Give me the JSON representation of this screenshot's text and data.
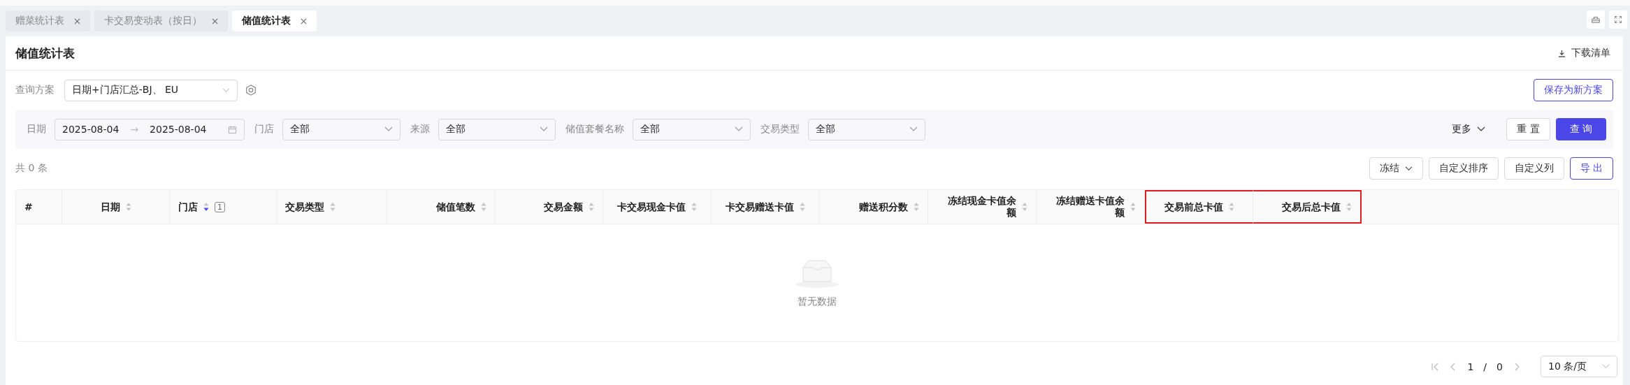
{
  "tabs": [
    {
      "label": "赠菜统计表",
      "selected": false
    },
    {
      "label": "卡交易变动表（按日）",
      "selected": false
    },
    {
      "label": "储值统计表",
      "selected": true
    }
  ],
  "page": {
    "title": "储值统计表",
    "download": "下载清单"
  },
  "scheme": {
    "label": "查询方案",
    "value": "日期+门店汇总-BJ、 EU",
    "save": "保存为新方案"
  },
  "filters": [
    {
      "kind": "daterange",
      "label": "日期",
      "start": "2025-08-04",
      "separator": "→",
      "end": "2025-08-04"
    },
    {
      "kind": "select",
      "label": "门店",
      "value": "全部"
    },
    {
      "kind": "select",
      "label": "来源",
      "value": "全部"
    },
    {
      "kind": "select",
      "label": "储值套餐名称",
      "value": "全部"
    },
    {
      "kind": "select",
      "label": "交易类型",
      "value": "全部"
    }
  ],
  "filter_actions": {
    "more": "更多",
    "reset": "重 置",
    "query": "查 询"
  },
  "count": "共 0 条",
  "table_actions": [
    {
      "kind": "dropdown",
      "label": "冻结"
    },
    {
      "kind": "plain",
      "label": "自定义排序"
    },
    {
      "kind": "plain",
      "label": "自定义列"
    },
    {
      "kind": "primary",
      "label": "导 出"
    }
  ],
  "columns": [
    {
      "kind": "index",
      "label": "#",
      "highlighted": false
    },
    {
      "kind": "sortable",
      "label": "日期",
      "sorted_descending": false,
      "highlighted": false
    },
    {
      "kind": "sortable",
      "label": "门店",
      "sorted_descending": true,
      "sort_badge": "1",
      "highlighted": false
    },
    {
      "kind": "sortable",
      "label": "交易类型",
      "sorted_descending": false,
      "highlighted": false
    },
    {
      "kind": "sortable",
      "label": "储值笔数",
      "sorted_descending": false,
      "highlighted": false
    },
    {
      "kind": "sortable",
      "label": "交易金额",
      "sorted_descending": false,
      "highlighted": false
    },
    {
      "kind": "sortable",
      "label": "卡交易现金卡值",
      "sorted_descending": false,
      "highlighted": false
    },
    {
      "kind": "sortable",
      "label": "卡交易赠送卡值",
      "sorted_descending": false,
      "highlighted": false
    },
    {
      "kind": "sortable",
      "label": "赠送积分数",
      "sorted_descending": false,
      "highlighted": false
    },
    {
      "kind": "sortable",
      "label": "冻结现金卡值余额",
      "sorted_descending": false,
      "highlighted": false
    },
    {
      "kind": "sortable",
      "label": "冻结赠送卡值余额",
      "sorted_descending": false,
      "highlighted": false
    },
    {
      "kind": "sortable",
      "label": "交易前总卡值",
      "sorted_descending": false,
      "highlighted": true
    },
    {
      "kind": "sortable",
      "label": "交易后总卡值",
      "sorted_descending": false,
      "highlighted": true
    }
  ],
  "empty_text": "暂无数据",
  "pagination": {
    "current": "1",
    "separator": "/",
    "total": "0",
    "page_size": "10 条/页"
  }
}
